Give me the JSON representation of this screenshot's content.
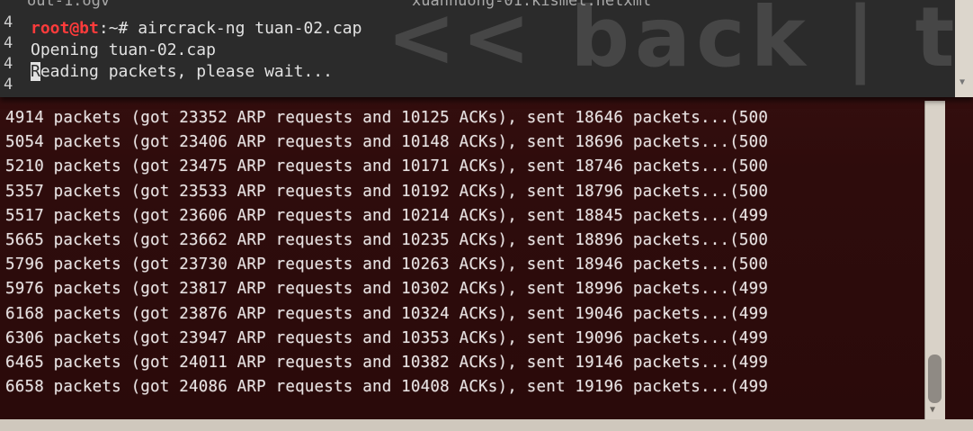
{
  "background_terminal": {
    "lines": [
      "4914 packets (got 23352 ARP requests and 10125 ACKs), sent 18646 packets...(500",
      "5054 packets (got 23406 ARP requests and 10148 ACKs), sent 18696 packets...(500",
      "5210 packets (got 23475 ARP requests and 10171 ACKs), sent 18746 packets...(500",
      "5357 packets (got 23533 ARP requests and 10192 ACKs), sent 18796 packets...(500",
      "5517 packets (got 23606 ARP requests and 10214 ACKs), sent 18845 packets...(499",
      "5665 packets (got 23662 ARP requests and 10235 ACKs), sent 18896 packets...(500",
      "5796 packets (got 23730 ARP requests and 10263 ACKs), sent 18946 packets...(500",
      "5976 packets (got 23817 ARP requests and 10302 ACKs), sent 18996 packets...(499",
      "6168 packets (got 23876 ARP requests and 10324 ACKs), sent 19046 packets...(499",
      "6306 packets (got 23947 ARP requests and 10353 ACKs), sent 19096 packets...(499",
      "6465 packets (got 24011 ARP requests and 10382 ACKs), sent 19146 packets...(499",
      "6658 packets (got 24086 ARP requests and 10408 ACKs), sent 19196 packets...(499"
    ]
  },
  "foreground_terminal": {
    "top_partial_left": "out-1.ogv",
    "top_partial_right": "xuanhuong-01.kismet.netxml",
    "left_strip": [
      "4",
      "4",
      "4",
      "4"
    ],
    "prompt_user": "root@bt",
    "prompt_rest": ":~# ",
    "command": "aircrack-ng tuan-02.cap",
    "line2": "Opening tuan-02.cap",
    "line3_cursor": "R",
    "line3_rest": "eading packets, please wait...",
    "wallpaper_text": "<< back | tra"
  },
  "colors": {
    "prompt_red": "#ff3b3b",
    "terminal_bg_dark_red": "#2e0c0c",
    "terminal_bg_grey": "#2b2b2b"
  }
}
